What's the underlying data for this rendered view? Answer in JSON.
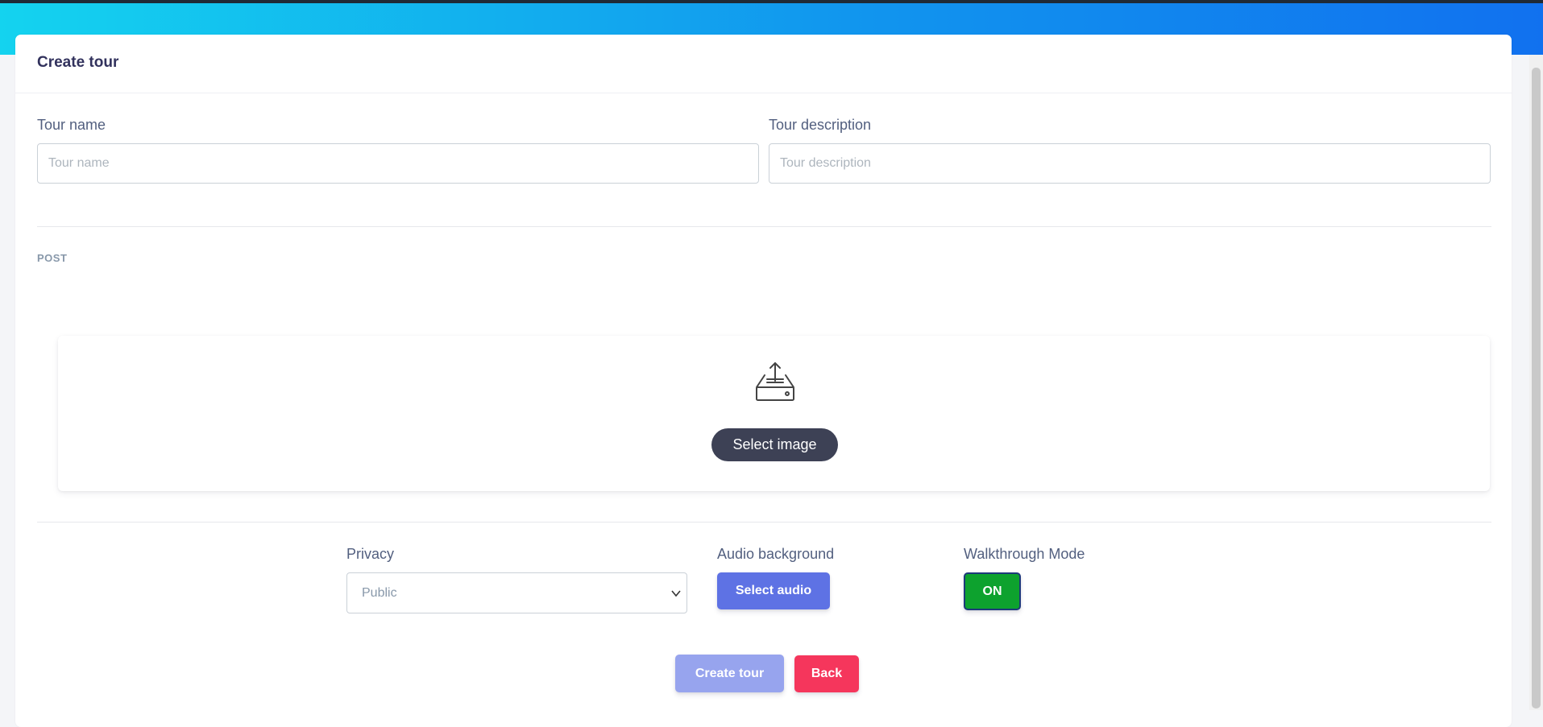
{
  "form": {
    "title": "Create tour",
    "tour_name": {
      "label": "Tour name",
      "placeholder": "Tour name",
      "value": ""
    },
    "tour_description": {
      "label": "Tour description",
      "placeholder": "Tour description",
      "value": ""
    },
    "post_section_label": "POST",
    "upload": {
      "icon": "inbox-upload-icon",
      "button_label": "Select image"
    },
    "privacy": {
      "label": "Privacy",
      "selected": "Public"
    },
    "audio_background": {
      "label": "Audio background",
      "button_label": "Select audio"
    },
    "walkthrough_mode": {
      "label": "Walkthrough Mode",
      "state_label": "ON"
    },
    "actions": {
      "create_label": "Create tour",
      "back_label": "Back"
    }
  },
  "colors": {
    "header_gradient_start": "#14d3ef",
    "header_gradient_end": "#1171ef",
    "primary": "#5e72e4",
    "primary_disabled": "#97a4ee",
    "success": "#0da22e",
    "danger": "#f5365c",
    "dark_button": "#3d4155"
  }
}
